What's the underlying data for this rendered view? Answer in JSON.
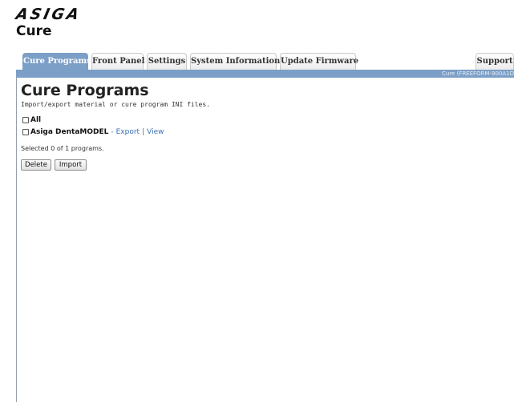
{
  "header": {
    "logo_text": "ASIGA",
    "app_title": "Cure"
  },
  "tabs": [
    {
      "label": "Cure Programs",
      "active": true
    },
    {
      "label": "Front Panel",
      "active": false
    },
    {
      "label": "Settings",
      "active": false
    },
    {
      "label": "System Information",
      "active": false
    },
    {
      "label": "Update Firmware",
      "active": false
    },
    {
      "label": "Support",
      "active": false
    }
  ],
  "status_bar": {
    "text": "Cure (FREEFORM-900A1D"
  },
  "main": {
    "title": "Cure Programs",
    "description": "Import/export material or cure program INI files.",
    "all_label": "All",
    "programs": [
      {
        "name": "Asiga DentaMODEL",
        "dash": "-",
        "export_label": "Export",
        "separator": "|",
        "view_label": "View",
        "checked": false
      }
    ],
    "selected_text": "Selected 0 of 1 programs.",
    "delete_label": "Delete",
    "import_label": "Import"
  },
  "colors": {
    "accent": "#7b9fc6",
    "link": "#3b6fb0"
  }
}
